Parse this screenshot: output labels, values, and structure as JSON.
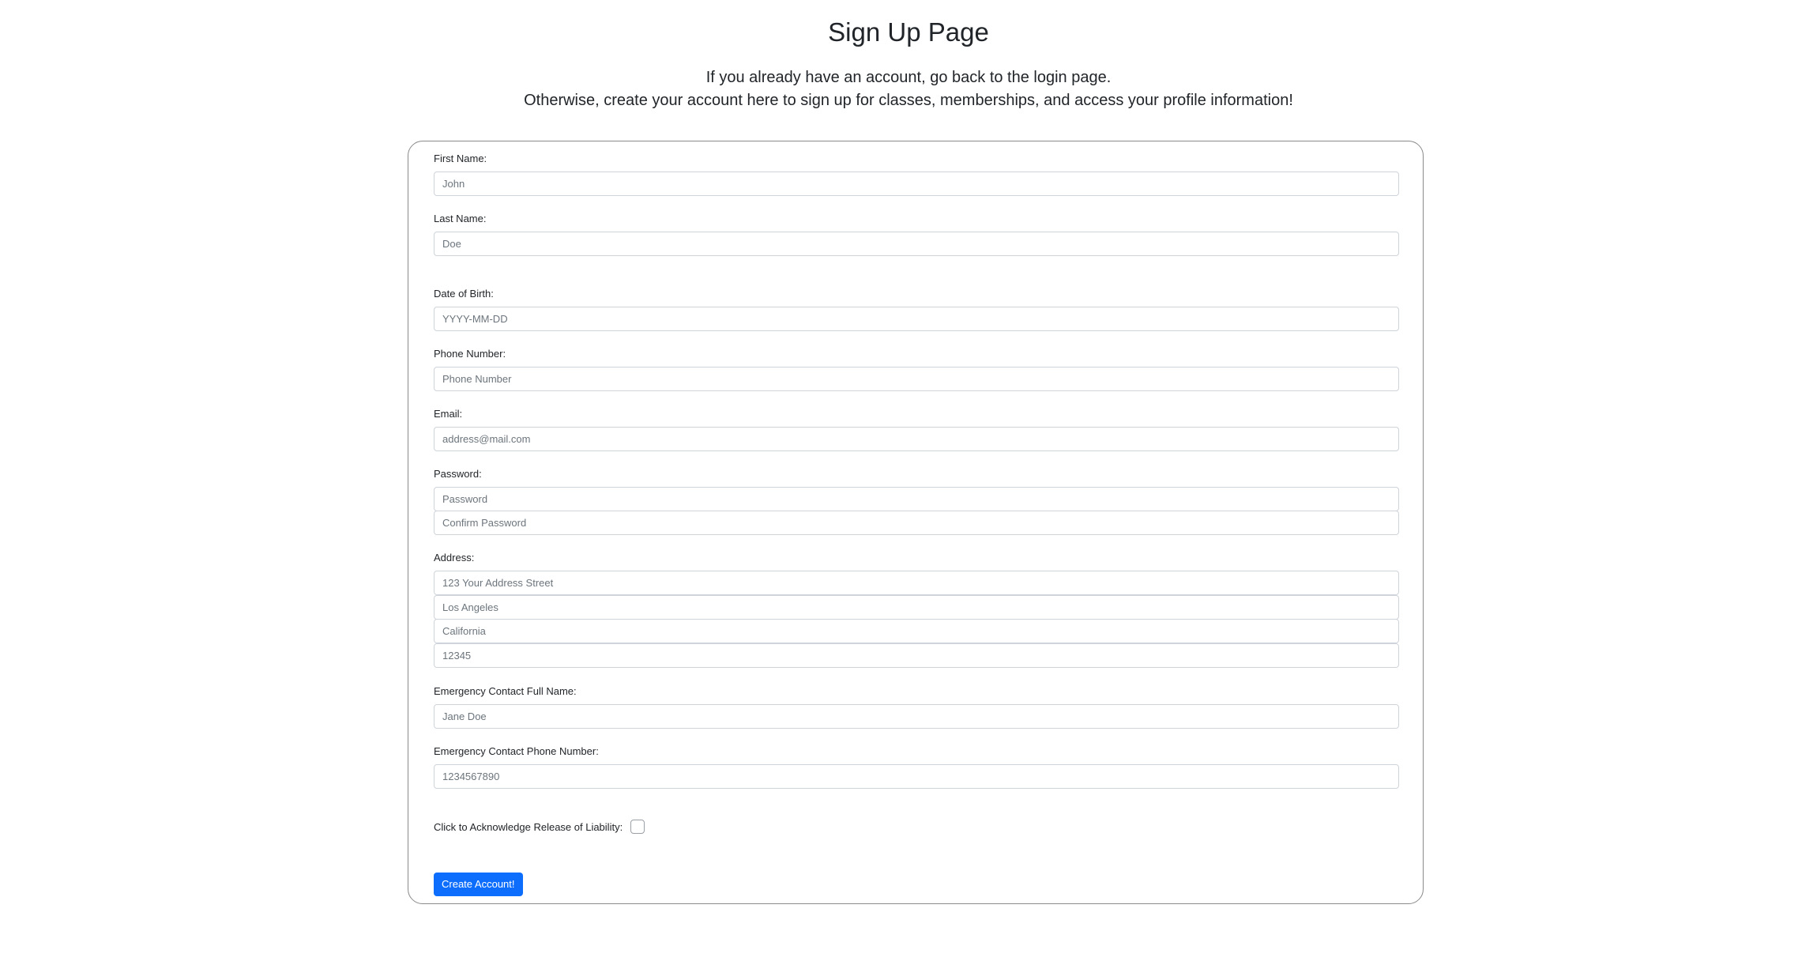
{
  "header": {
    "title": "Sign Up Page",
    "intro_line1": "If you already have an account, go back to the login page.",
    "intro_line2": "Otherwise, create your account here to sign up for classes, memberships, and access your profile information!"
  },
  "form": {
    "first_name": {
      "label": "First Name:",
      "placeholder": "John"
    },
    "last_name": {
      "label": "Last Name:",
      "placeholder": "Doe"
    },
    "dob": {
      "label": "Date of Birth:",
      "placeholder": "YYYY-MM-DD"
    },
    "phone": {
      "label": "Phone Number:",
      "placeholder": "Phone Number"
    },
    "email": {
      "label": "Email:",
      "placeholder": "address@mail.com"
    },
    "password": {
      "label": "Password:",
      "placeholder": "Password",
      "confirm_placeholder": "Confirm Password"
    },
    "address": {
      "label": "Address:",
      "street_placeholder": "123 Your Address Street",
      "city_placeholder": "Los Angeles",
      "state_placeholder": "California",
      "zip_placeholder": "12345"
    },
    "emergency_name": {
      "label": "Emergency Contact Full Name:",
      "placeholder": "Jane Doe"
    },
    "emergency_phone": {
      "label": "Emergency Contact Phone Number:",
      "placeholder": "1234567890"
    },
    "liability": {
      "label": "Click to Acknowledge Release of Liability:",
      "checked": false
    },
    "submit_label": "Create Account!"
  },
  "colors": {
    "primary_button": "#0d6efd",
    "card_border": "#8a8a8a",
    "input_border": "#ced4da"
  }
}
